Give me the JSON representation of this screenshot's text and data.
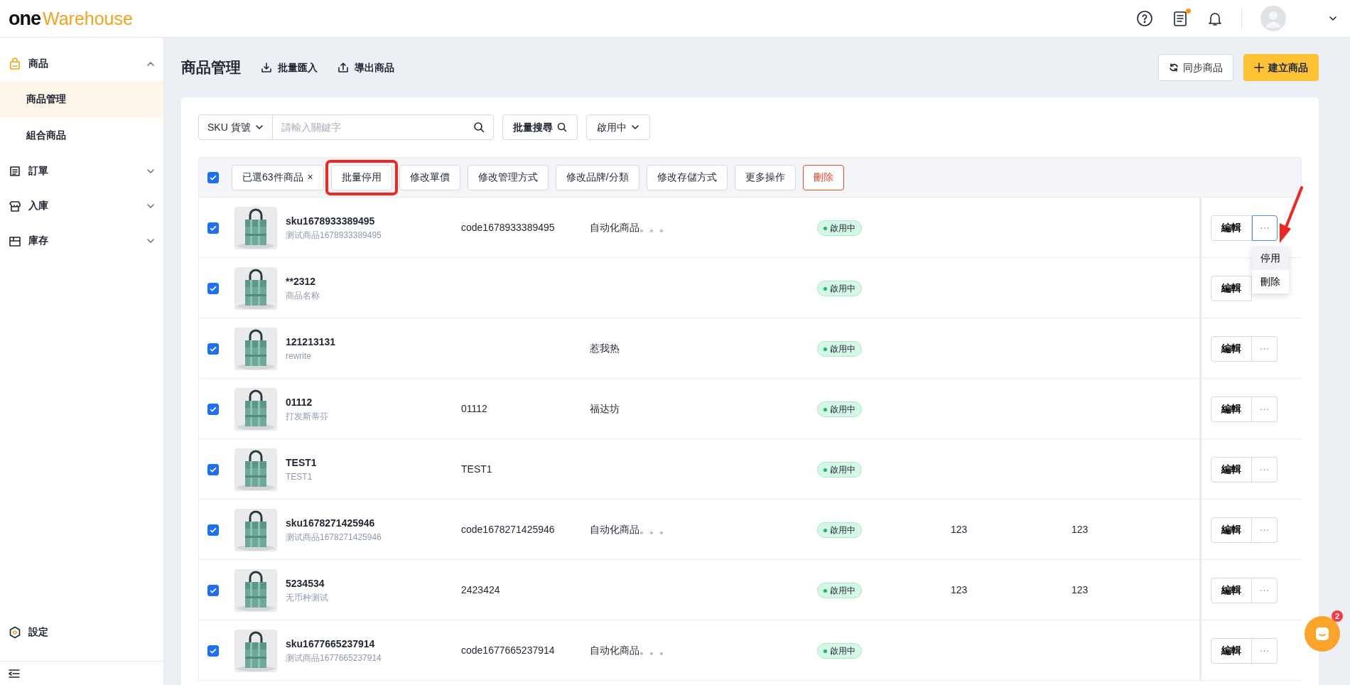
{
  "header": {
    "logo": {
      "part_1": "one",
      "part_2": "Warehouse"
    },
    "task_dot": true
  },
  "sidebar": {
    "items": [
      {
        "label": "商品",
        "expanded": true,
        "children": [
          {
            "label": "商品管理",
            "selected": true
          },
          {
            "label": "組合商品",
            "selected": false
          }
        ]
      },
      {
        "label": "訂單",
        "expanded": false
      },
      {
        "label": "入庫",
        "expanded": false
      },
      {
        "label": "庫存",
        "expanded": false
      }
    ],
    "footer_item": {
      "label": "設定"
    }
  },
  "page": {
    "title": "商品管理",
    "links": [
      {
        "label": "批量匯入",
        "kind": "import"
      },
      {
        "label": "導出商品",
        "kind": "export"
      }
    ],
    "buttons": [
      {
        "label": "同步商品",
        "kind": "sync"
      },
      {
        "label": "建立商品",
        "kind": "create"
      }
    ]
  },
  "filters": {
    "field_select": "SKU 貨號",
    "search": {
      "placeholder": "請輸入關鍵字"
    },
    "bulk_search": "批量搜尋",
    "status_select": "啟用中"
  },
  "bulk_bar": {
    "select_all_checked": true,
    "selection": "已選63件商品",
    "clear": "×",
    "actions": [
      {
        "label": "批量停用",
        "kind": "default",
        "highlighted": true
      },
      {
        "label": "修改單價",
        "kind": "default",
        "highlighted": false
      },
      {
        "label": "修改管理方式",
        "kind": "default",
        "highlighted": false
      },
      {
        "label": "修改品牌/分類",
        "kind": "default",
        "highlighted": false
      },
      {
        "label": "修改存儲方式",
        "kind": "default",
        "highlighted": false
      },
      {
        "label": "更多操作",
        "kind": "default",
        "highlighted": false
      },
      {
        "label": "刪除",
        "kind": "danger",
        "highlighted": false
      }
    ]
  },
  "rows": [
    {
      "checked": true,
      "sku": "sku1678933389495",
      "name": "测试商品1678933389495",
      "code": "code1678933389495",
      "brand": "自动化商品。。。",
      "status": "啟用中",
      "edit": "編輯",
      "more": "···",
      "menu": [
        {
          "label": "停用",
          "selected": true
        },
        {
          "label": "刪除",
          "selected": false
        }
      ]
    },
    {
      "checked": true,
      "sku": "**2312",
      "name": "商品名称",
      "status": "啟用中",
      "edit": "編輯"
    },
    {
      "checked": true,
      "sku": "121213131",
      "name": "rewrite",
      "brand": "惹我热",
      "status": "啟用中",
      "edit": "編輯",
      "more": "···"
    },
    {
      "checked": true,
      "sku": "01112",
      "name": "打发斯蒂芬",
      "code": "01112",
      "brand": "福达坊",
      "status": "啟用中",
      "edit": "編輯",
      "more": "···"
    },
    {
      "checked": true,
      "sku": "TEST1",
      "name": "TEST1",
      "code": "TEST1",
      "status": "啟用中",
      "edit": "編輯",
      "more": "···"
    },
    {
      "checked": true,
      "sku": "sku1678271425946",
      "name": "测试商品1678271425946",
      "code": "code1678271425946",
      "brand": "自动化商品。。。",
      "status": "啟用中",
      "column_6": "123",
      "column_7": "123",
      "edit": "編輯",
      "more": "···"
    },
    {
      "checked": true,
      "sku": "5234534",
      "name": "无币种测试",
      "code": "2423424",
      "status": "啟用中",
      "column_6": "123",
      "column_7": "123",
      "edit": "編輯",
      "more": "···"
    },
    {
      "checked": true,
      "sku": "sku1677665237914",
      "name": "测试商品1677665237914",
      "code": "code1677665237914",
      "brand": "自动化商品。。。",
      "status": "啟用中",
      "edit": "編輯",
      "more": "···"
    }
  ],
  "chat": {
    "badge": "2"
  },
  "annotation_arrow": true
}
